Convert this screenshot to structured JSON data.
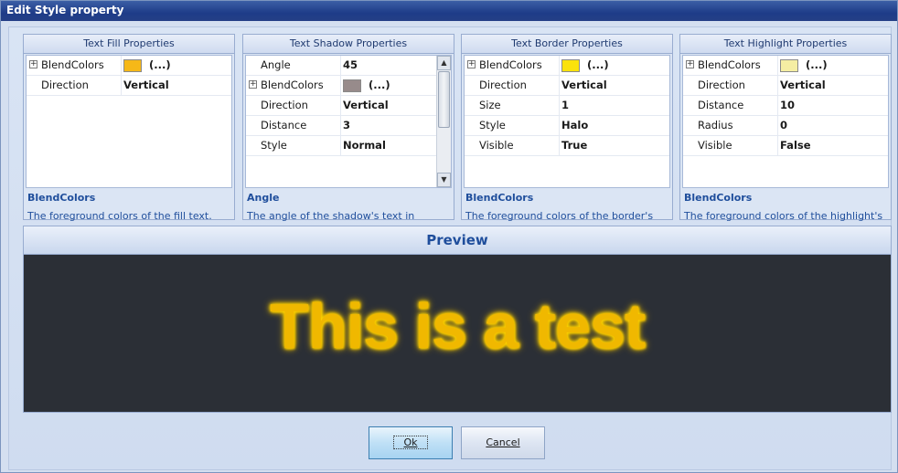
{
  "window": {
    "title": "Edit Style property"
  },
  "panels": [
    {
      "header": "Text Fill Properties",
      "rows": [
        {
          "name": "BlendColors",
          "value": "(...)",
          "expandable": true,
          "swatch": "#f6b818"
        },
        {
          "name": "Direction",
          "value": "Vertical"
        }
      ],
      "desc_title": "BlendColors",
      "desc_text": "The foreground colors of the fill text."
    },
    {
      "header": "Text Shadow Properties",
      "rows": [
        {
          "name": "Angle",
          "value": "45"
        },
        {
          "name": "BlendColors",
          "value": "(...)",
          "expandable": true,
          "swatch": "#978b8b"
        },
        {
          "name": "Direction",
          "value": "Vertical"
        },
        {
          "name": "Distance",
          "value": "3"
        },
        {
          "name": "Style",
          "value": "Normal"
        }
      ],
      "desc_title": "Angle",
      "desc_text": "The angle of the shadow's text in degrees."
    },
    {
      "header": "Text Border Properties",
      "rows": [
        {
          "name": "BlendColors",
          "value": "(...)",
          "expandable": true,
          "swatch": "#fbe20c"
        },
        {
          "name": "Direction",
          "value": "Vertical"
        },
        {
          "name": "Size",
          "value": "1"
        },
        {
          "name": "Style",
          "value": "Halo"
        },
        {
          "name": "Visible",
          "value": "True"
        }
      ],
      "desc_title": "BlendColors",
      "desc_text": "The foreground colors of the border's text."
    },
    {
      "header": "Text Highlight Properties",
      "rows": [
        {
          "name": "BlendColors",
          "value": "(...)",
          "expandable": true,
          "swatch": "#f5eea3"
        },
        {
          "name": "Direction",
          "value": "Vertical"
        },
        {
          "name": "Distance",
          "value": "10"
        },
        {
          "name": "Radius",
          "value": "0"
        },
        {
          "name": "Visible",
          "value": "False"
        }
      ],
      "desc_title": "BlendColors",
      "desc_text": "The foreground colors of the highlight's text."
    }
  ],
  "preview": {
    "header": "Preview",
    "text": "This is a test"
  },
  "buttons": {
    "ok": "Ok",
    "cancel": "Cancel"
  },
  "colors": {
    "title_bar": "#1e3c88",
    "preview_bg": "#2b2f36",
    "preview_text": "#f0b800",
    "description_text": "#1f4e9c"
  }
}
